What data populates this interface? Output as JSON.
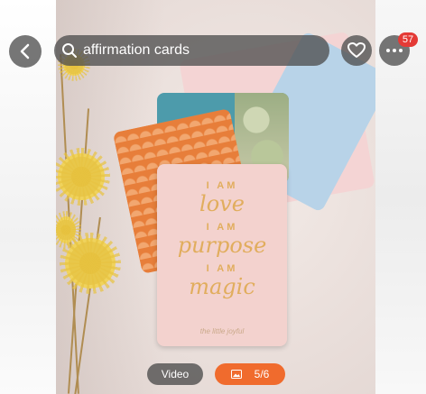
{
  "search": {
    "query": "affirmation cards"
  },
  "header": {
    "badge_count": "57"
  },
  "card_text": {
    "line1_small": "I AM",
    "line1_word": "love",
    "line2_small": "I AM",
    "line2_word": "purpose",
    "line3_small": "I AM",
    "line3_word": "magic",
    "signature": "the little joyful"
  },
  "media": {
    "video_label": "Video",
    "photo_counter": "5/6"
  },
  "colors": {
    "badge": "#e43a36",
    "photo_pill": "#f06b2d",
    "overlay": "#505050"
  },
  "icons": [
    "back-icon",
    "search-icon",
    "heart-icon",
    "more-icon",
    "image-icon"
  ]
}
